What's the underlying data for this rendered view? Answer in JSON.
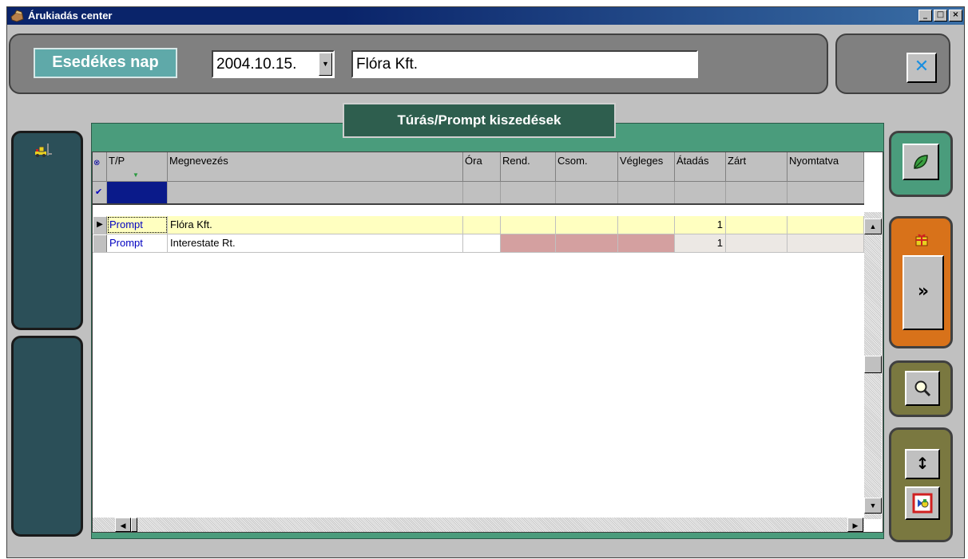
{
  "window": {
    "title": "Árukiadás center",
    "minimize": "_",
    "maximize": "□",
    "close": "×"
  },
  "top": {
    "due_label": "Esedékes nap",
    "date_value": "2004.10.15.",
    "customer_value": "Flóra Kft."
  },
  "grid": {
    "title": "Túrás/Prompt kiszedések",
    "columns": [
      "T/P",
      "Megnevezés",
      "Óra",
      "Rend.",
      "Csom.",
      "Végleges",
      "Átadás",
      "Zárt",
      "Nyomtatva"
    ],
    "rows": [
      {
        "tp": "Prompt",
        "name": "Flóra Kft.",
        "ora": "",
        "rend": "",
        "csom": "",
        "vegleges": "",
        "atadas": "1",
        "zart": "",
        "nyomtatva": ""
      },
      {
        "tp": "Prompt",
        "name": "Interestate Rt.",
        "ora": "",
        "rend": "",
        "csom": "",
        "vegleges": "",
        "atadas": "1",
        "zart": "",
        "nyomtatva": ""
      }
    ]
  },
  "icons": {
    "app": "app-icon",
    "forklift": "forklift-icon",
    "leaf": "leaf-icon",
    "gift": "gift-icon",
    "next": "double-chevron-right-icon",
    "search": "magnifier-icon",
    "resize": "vertical-arrows-icon",
    "shapes": "shapes-icon"
  },
  "colors": {
    "title_bar": "#0a246a",
    "accent_teal": "#5fa9a9",
    "grid_frame": "#4a9c7c",
    "selected_row": "#ffffc0",
    "pink_cells": "#d4a0a0",
    "tp_text": "#0000c0",
    "orange_panel": "#d8721a"
  }
}
